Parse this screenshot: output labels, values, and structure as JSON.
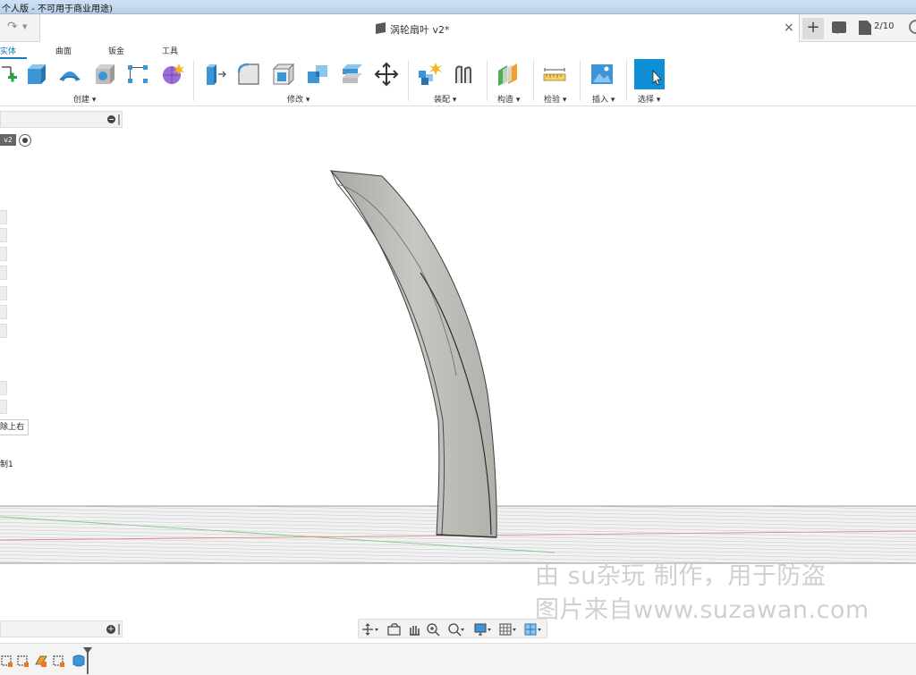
{
  "titlebar": {
    "text": "个人版 - 不可用于商业用途)"
  },
  "document_tab": {
    "title": "涡轮扇叶 v2*",
    "close": "×"
  },
  "header_right": {
    "new_tab": "+",
    "job_status": "2/10"
  },
  "ribbon": {
    "tabs": [
      {
        "label": "实体",
        "active": true
      },
      {
        "label": "曲面",
        "active": false
      },
      {
        "label": "钣金",
        "active": false
      },
      {
        "label": "工具",
        "active": false
      }
    ],
    "groups": [
      {
        "label": "创建 ▾"
      },
      {
        "label": "修改 ▾"
      },
      {
        "label": "装配 ▾"
      },
      {
        "label": "构造 ▾"
      },
      {
        "label": "检验 ▾"
      },
      {
        "label": "插入 ▾"
      },
      {
        "label": "选择 ▾"
      }
    ]
  },
  "browser": {
    "version_tag": "v2",
    "item_top_right": "除上右",
    "item_1": "制1"
  },
  "watermark": {
    "line1": "由 su杂玩 制作，用于防盗",
    "line2": "图片来自www.suzawan.com"
  },
  "colors": {
    "accent": "#0f7cc4",
    "model_fill": "#b9b9b3",
    "ground_grid": "#b8b8b8"
  }
}
